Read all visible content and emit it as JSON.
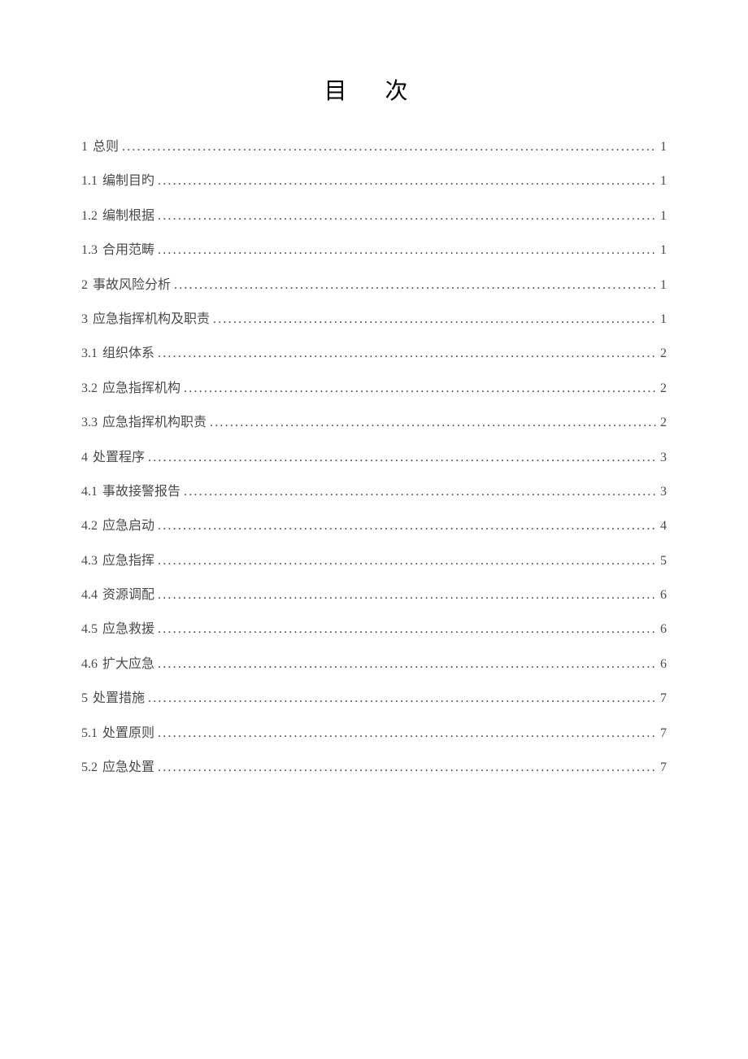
{
  "title": "目  次",
  "toc": [
    {
      "num": "1",
      "label": "总则",
      "page": "1"
    },
    {
      "num": "1.1",
      "label": "编制目旳",
      "page": "1"
    },
    {
      "num": "1.2",
      "label": "编制根据",
      "page": "1"
    },
    {
      "num": "1.3",
      "label": "合用范畴",
      "page": "1"
    },
    {
      "num": "2",
      "label": "事故风险分析",
      "page": "1"
    },
    {
      "num": "3",
      "label": "应急指挥机构及职责",
      "page": "1"
    },
    {
      "num": "3.1",
      "label": "组织体系",
      "page": "2"
    },
    {
      "num": "3.2",
      "label": "应急指挥机构",
      "page": "2"
    },
    {
      "num": "3.3",
      "label": "应急指挥机构职责",
      "page": "2"
    },
    {
      "num": "4",
      "label": "处置程序",
      "page": "3"
    },
    {
      "num": "4.1",
      "label": "事故接警报告",
      "page": "3"
    },
    {
      "num": "4.2",
      "label": "应急启动",
      "page": "4"
    },
    {
      "num": "4.3",
      "label": "应急指挥",
      "page": "5"
    },
    {
      "num": "4.4",
      "label": "资源调配",
      "page": "6"
    },
    {
      "num": "4.5",
      "label": "应急救援",
      "page": "6"
    },
    {
      "num": "4.6",
      "label": "扩大应急",
      "page": "6"
    },
    {
      "num": "5",
      "label": "处置措施",
      "page": "7"
    },
    {
      "num": "5.1",
      "label": "处置原则",
      "page": "7"
    },
    {
      "num": "5.2",
      "label": "应急处置",
      "page": "7"
    }
  ]
}
